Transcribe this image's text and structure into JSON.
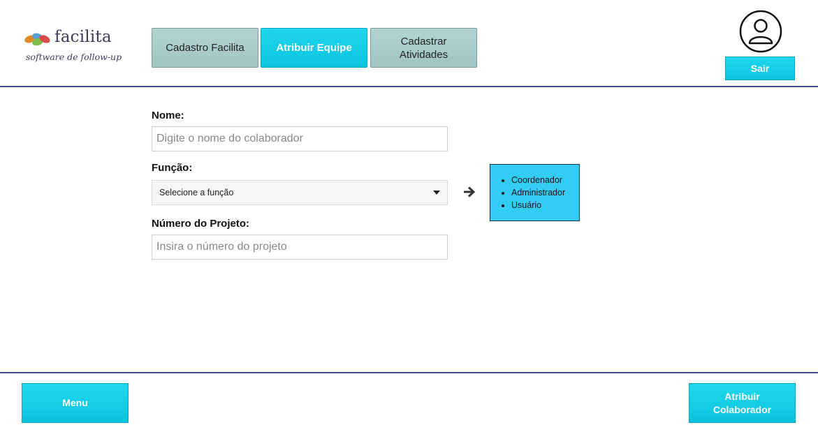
{
  "logo": {
    "name": "facilita",
    "tagline": "software de follow-up"
  },
  "tabs": [
    {
      "label": "Cadastro Facilita",
      "active": false
    },
    {
      "label": "Atribuir Equipe",
      "active": true
    },
    {
      "label": "Cadastrar\nAtividades",
      "active": false
    }
  ],
  "header": {
    "avatar_icon": "user-avatar-icon",
    "logout_label": "Sair"
  },
  "form": {
    "nome_label": "Nome:",
    "nome_placeholder": "Digite o nome do colaborador",
    "funcao_label": "Função:",
    "funcao_selected": "Selecione a função",
    "projeto_label": "Número do Projeto:",
    "projeto_placeholder": "Insira o número do projeto"
  },
  "funcao_options": [
    "Coordenador",
    "Administrador",
    "Usuário"
  ],
  "footer": {
    "menu_label": "Menu",
    "atribuir_label": "Atribuir\nColaborador"
  },
  "colors": {
    "accent": "#0ac4de",
    "tab_inactive": "#a8caca",
    "options_box": "#33ccf5",
    "divider": "#3b4b86"
  }
}
